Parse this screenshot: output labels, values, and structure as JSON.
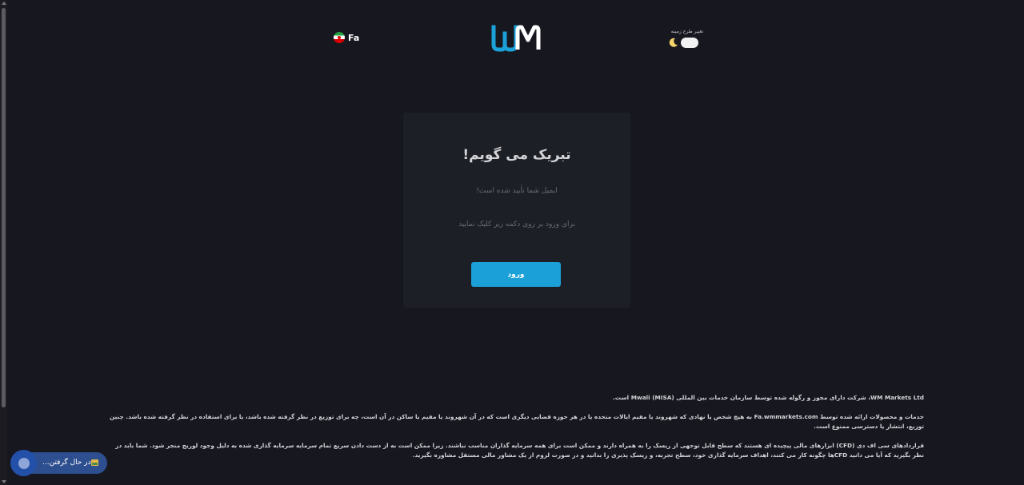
{
  "header": {
    "language_label": "Fa",
    "logo_text": "WM",
    "theme_label": "تغییر طرح زمینه"
  },
  "card": {
    "title": "تبریک می گویم!",
    "message_confirmed": "ایمیل شما تأیید شده است!",
    "message_instruction": "برای ورود بر روی دکمه زیر کلیک نمایید",
    "login_button": "ورود"
  },
  "footer": {
    "p1": "WM Markets Ltd، شرکت دارای مجوز و رگوله شده توسط سازمان خدمات بین المللی (Mwali (MISA است.",
    "p2": "خدمات و محصولات ارائه شده توسط Fa.wmmarkets.com به هیچ شخص یا نهادی که شهروند یا مقیم ایالات متحده یا در هر حوزه قضایی دیگری است که در آن شهروند یا مقیم یا ساکن در آن است، چه برای توزیع در نظر گرفته شده باشد، یا برای استفاده در نظر گرفته شده باشد. چنین توزیع، انتشار یا دسترسی ممنوع است.",
    "p3": "قراردادهای سی اف دی (CFD) ابزارهای مالی پیچیده ای هستند که سطح قابل توجهی از ریسک را به همراه دارند و ممکن است برای همه سرمایه گذاران مناسب نباشند. زیرا ممکن است به از دست دادن سریع تمام سرمایه سرمایه گذاری شده به دلیل وجود لوریج منجر شود. شما باید در نظر بگیرید که آیا می دانید CFDها چگونه کار می کنند، اهداف سرمایه گذاری خود، سطح تجربه، و ریسک پذیری را بدانید و در صورت لزوم از یک مشاور مالی مستقل مشاوره بگیرید."
  },
  "loading_widget": {
    "text": "در حال گرفتن..."
  },
  "colors": {
    "background": "#17171f",
    "card": "#1d1f26",
    "accent": "#1ba0d8"
  }
}
